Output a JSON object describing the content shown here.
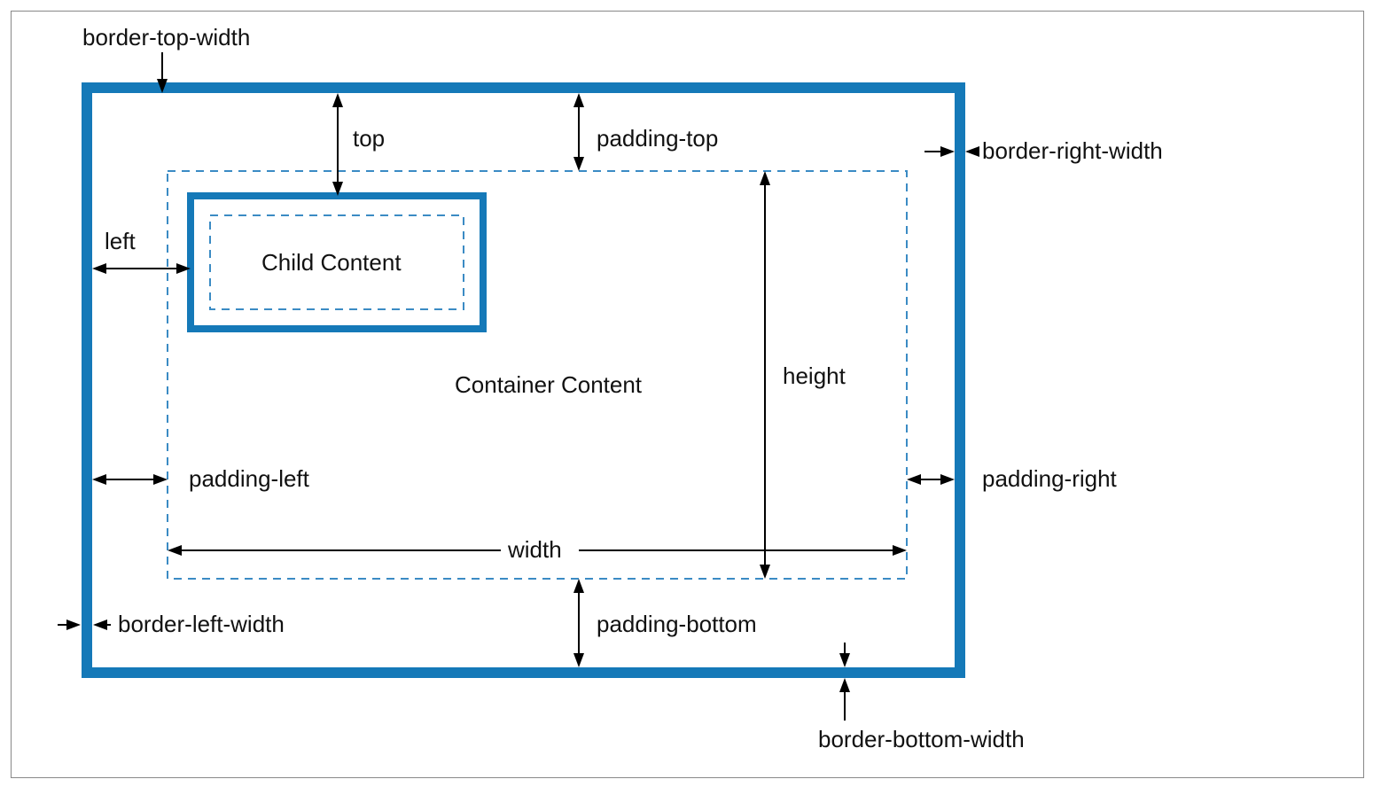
{
  "labels": {
    "borderTopWidth": "border-top-width",
    "borderRightWidth": "border-right-width",
    "borderBottomWidth": "border-bottom-width",
    "borderLeftWidth": "border-left-width",
    "paddingTop": "padding-top",
    "paddingRight": "padding-right",
    "paddingBottom": "padding-bottom",
    "paddingLeft": "padding-left",
    "top": "top",
    "left": "left",
    "width": "width",
    "height": "height",
    "containerContent": "Container Content",
    "childContent": "Child Content"
  },
  "colors": {
    "border": "#1579b8",
    "dash": "#3b8bc4"
  }
}
